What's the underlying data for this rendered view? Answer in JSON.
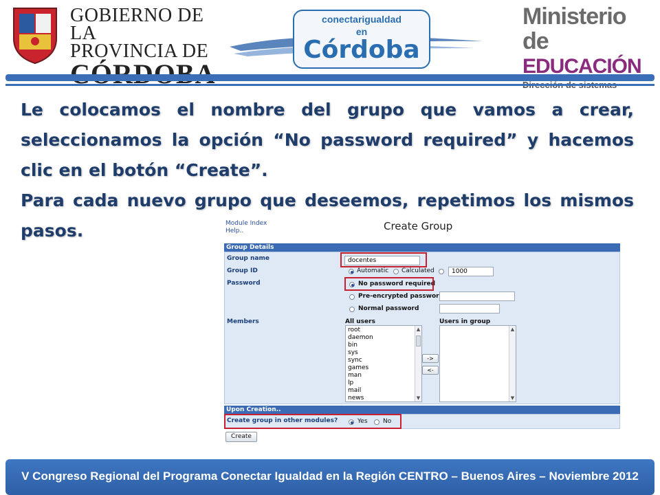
{
  "header": {
    "gov_logo": {
      "line1": "GOBIERNO DE LA",
      "line2": "PROVINCIA DE",
      "line3": "CÓRDOBA"
    },
    "center_logo": {
      "line1": "conectarigualdad",
      "line2": "en",
      "line3": "Córdoba"
    },
    "right_logo": {
      "line1": "Ministerio de",
      "line2": "EDUCACIÓN",
      "line3": "Dirección de sistemas"
    }
  },
  "body": {
    "paragraph1": "Le colocamos el nombre del grupo que vamos a crear, seleccionamos la opción “No password required” y hacemos clic en el botón “Create”.",
    "paragraph2": "Para cada nuevo grupo que deseemos, repetimos los mismos pasos."
  },
  "form": {
    "nav": {
      "module_index": "Module Index",
      "help": "Help.."
    },
    "title": "Create Group",
    "group_details_header": "Group Details",
    "group_name_label": "Group name",
    "group_name_value": "docentes",
    "group_id_label": "Group ID",
    "gid_automatic": "Automatic",
    "gid_calculated": "Calculated",
    "gid_value": "1000",
    "password_label": "Password",
    "pw_none": "No password required",
    "pw_pre": "Pre-encrypted password",
    "pw_normal": "Normal password",
    "members_label": "Members",
    "all_users_label": "All users",
    "users_in_group_label": "Users in group",
    "all_users": [
      "root",
      "daemon",
      "bin",
      "sys",
      "sync",
      "games",
      "man",
      "lp",
      "mail",
      "news"
    ],
    "add_btn": "->",
    "remove_btn": "<-",
    "upon_creation_header": "Upon Creation..",
    "other_modules_label": "Create group in other modules?",
    "yes": "Yes",
    "no": "No",
    "create_btn": "Create"
  },
  "footer": {
    "text": "V Congreso Regional del Programa Conectar Igualdad en la Región CENTRO – Buenos Aires – Noviembre 2012"
  },
  "colors": {
    "accent_blue": "#3a6fb7",
    "text_navy": "#1f3d6b",
    "highlight_red": "#c8202f",
    "form_bg": "#dfe9f6"
  }
}
